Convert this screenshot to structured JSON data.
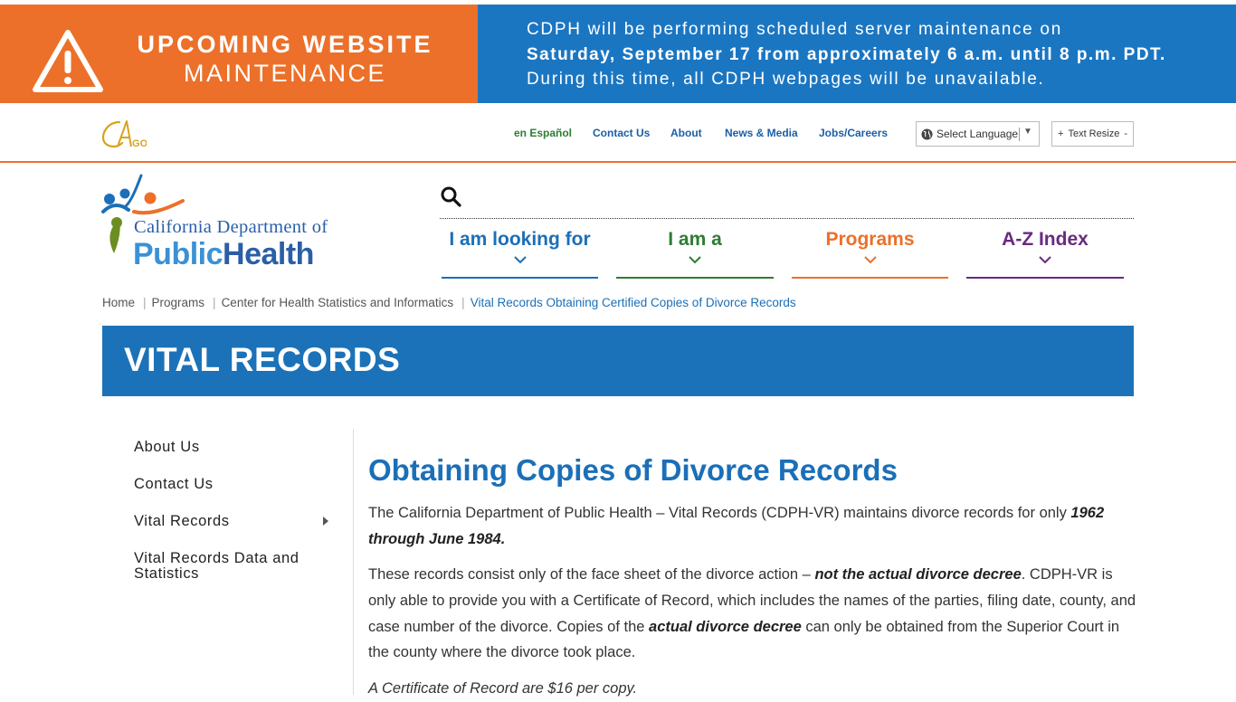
{
  "banner": {
    "title_line1": "UPCOMING WEBSITE",
    "title_line2": "MAINTENANCE",
    "msg_line1": "CDPH will be performing scheduled server maintenance on",
    "msg_line2": "Saturday, September 17 from approximately 6 a.m. until 8 p.m. PDT.",
    "msg_line3": "During this time, all CDPH webpages will be unavailable.",
    "left_color": "#ec702a",
    "right_color": "#1b76c2"
  },
  "utility": {
    "cagov_text": "CA.GOV",
    "links": [
      "en Español",
      "Contact Us",
      "About",
      "News & Media",
      "Jobs/Careers"
    ],
    "language_select": "Select Language",
    "text_resize_plus": "+",
    "text_resize_label": "Text Resize",
    "text_resize_minus": "-"
  },
  "logo": {
    "line1": "California Department of",
    "line2_a": "Public",
    "line2_b": "Health"
  },
  "mega_menu": [
    "I am looking for",
    "I am a",
    "Programs",
    "A-Z Index"
  ],
  "breadcrumb": {
    "items": [
      "Home",
      "Programs",
      "Center for Health Statistics and Informatics"
    ],
    "separator": "|",
    "current": "Vital Records Obtaining Certified Copies of Divorce Records"
  },
  "page_title": "VITAL RECORDS",
  "sidenav": {
    "items": [
      "About Us",
      "Contact Us",
      "Vital Records",
      "Vital Records Data and Statistics"
    ]
  },
  "content": {
    "heading": "Obtaining Copies of Divorce Records",
    "p1_a": "The California Department of Public Health – Vital Records (CDPH-VR) maintains divorce records for only ",
    "p1_b": "1962 through June 1984.",
    "p2_a": "These records consist only of the face sheet of the divorce action – ",
    "p2_b": "not the actual divorce decree",
    "p2_c": ". CDPH-VR is only able to provide you with a Certificate of Record, which includes the names of the parties, filing date, county, and case number of the divorce. Copies of the ",
    "p2_d": "actual divorce decree",
    "p2_e": " can only be obtained from the Superior Court in the county where the divorce took place.",
    "p3": "A Certificate of Record are $16 per copy."
  },
  "colors": {
    "brand_blue": "#1b72b8",
    "brand_orange": "#ec702a",
    "brand_green": "#2e7d32",
    "brand_purple": "#6a2a80"
  }
}
